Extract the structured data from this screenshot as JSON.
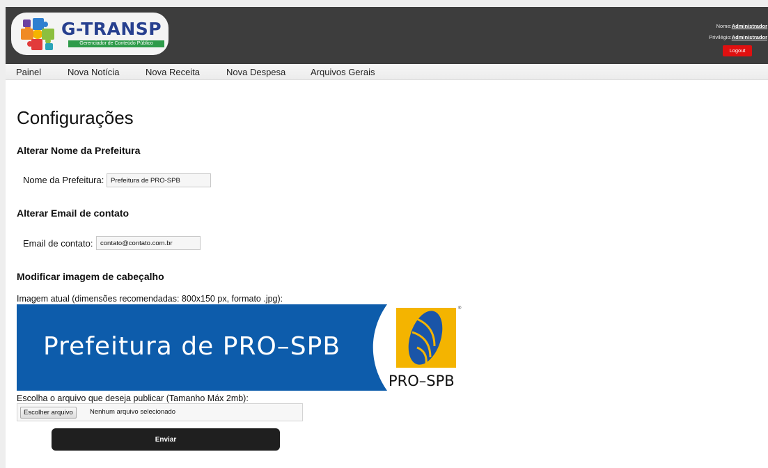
{
  "header": {
    "logo_title": "G-TRANSP",
    "logo_subtitle": "Gerenciador de Conteúdo Público",
    "user_name_label": "Nome:",
    "user_name": "Administrador",
    "privilege_label": "Privilégio:",
    "privilege": "Administrador",
    "logout_label": "Logout",
    "logout_color": "#e01010",
    "bar_color": "#3d3d3d"
  },
  "nav": {
    "items": [
      {
        "label": "Painel"
      },
      {
        "label": "Nova Notícia"
      },
      {
        "label": "Nova Receita"
      },
      {
        "label": "Nova Despesa"
      },
      {
        "label": "Arquivos Gerais"
      }
    ]
  },
  "main": {
    "page_title": "Configurações",
    "name_section": {
      "title": "Alterar Nome da Prefeitura",
      "label": "Nome da Prefeitura:",
      "value": "Prefeitura de PRO-SPB"
    },
    "email_section": {
      "title": "Alterar Email de contato",
      "label": "Email de contato:",
      "value": "contato@contato.com.br"
    },
    "image_section": {
      "title": "Modificar imagem de cabeçalho",
      "current_image_label": "Imagem atual (dimensões recomendadas: 800x150 px, formato .jpg):",
      "banner_text": "Prefeitura de PRO–SPB",
      "banner_logo_text": "PRO–SPB",
      "banner_color": "#0d5cab",
      "logo_square_color": "#f4b400",
      "choose_file_prompt": "Escolha o arquivo que deseja publicar (Tamanho Máx 2mb):",
      "choose_file_button": "Escolher arquivo",
      "no_file_selected": "Nenhum arquivo selecionado",
      "submit_label": "Enviar"
    }
  }
}
